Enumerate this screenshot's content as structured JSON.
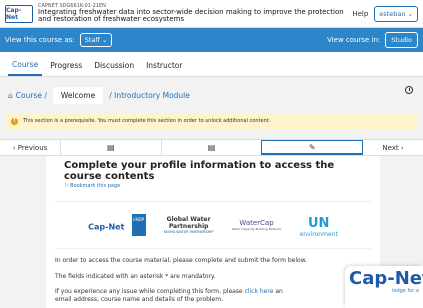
{
  "header": {
    "logo_text": "Cap-Net",
    "course_code": "CAPNET SDG661K-01-21EN",
    "course_title": "Integrating freshwater data into sector-wide decision making to improve the protection and restoration of freshwater ecosystems",
    "help_label": "Help",
    "username": "esteban"
  },
  "staffbar": {
    "view_as_label": "View this course as:",
    "view_as_value": "Staff",
    "view_in_label": "View course in:",
    "studio_label": "Studio"
  },
  "tabs": [
    {
      "label": "Course",
      "active": true
    },
    {
      "label": "Progress",
      "active": false
    },
    {
      "label": "Discussion",
      "active": false
    },
    {
      "label": "Instructor",
      "active": false
    }
  ],
  "breadcrumb": {
    "course": "Course",
    "current": "Welcome",
    "section": "Introductory Module"
  },
  "warning": {
    "text": "This section is a prerequisite. You must complete this section in order to unlock additional content."
  },
  "unit_nav": {
    "previous": "Previous",
    "next": "Next"
  },
  "content": {
    "heading": "Complete your profile information to access the course contents",
    "bookmark": "Bookmark this page",
    "logos": {
      "capnet": "Cap-Net",
      "undp": "UNDP",
      "gwp_line1": "Global Water",
      "gwp_line2": "Partnership",
      "gwp_sub": "KENYA WATER PARTNERSHIP",
      "watercap": "WaterCap",
      "watercap_sub": "Water Capacity Building Network",
      "un": "UN",
      "un_sub": "environment"
    },
    "p1": "In order to access the course material, please complete and submit the form below.",
    "p2": "The fields indicated with an asterisk * are mandatory.",
    "p3_before": "If you experience any issue while completing this form, please",
    "p3_link": "click here",
    "p3_after": "an",
    "p3_line2": "email address, course name and details of the problem."
  },
  "corner_logo": {
    "name": "Cap-Net",
    "tagline": "ledge for a"
  }
}
